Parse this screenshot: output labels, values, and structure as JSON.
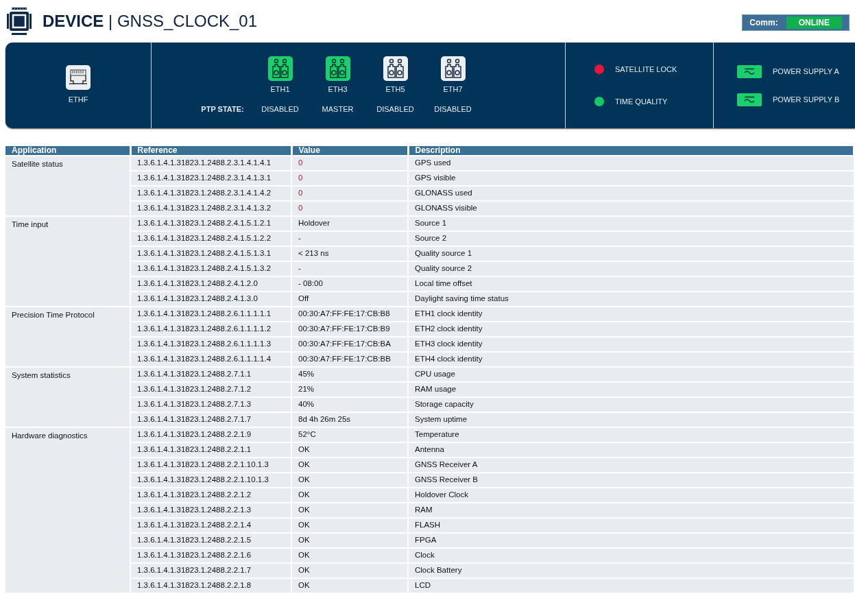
{
  "header": {
    "title_bold": "DEVICE",
    "separator": "|",
    "title_rest": "GNSS_CLOCK_01",
    "comm_label": "Comm:",
    "comm_status": "ONLINE",
    "comm_online": true
  },
  "panel": {
    "front_port": {
      "label": "ETHF"
    },
    "ptp_label": "PTP STATE:",
    "ports": [
      {
        "label": "ETH1",
        "state": "DISABLED",
        "active": true
      },
      {
        "label": "ETH3",
        "state": "MASTER",
        "active": true
      },
      {
        "label": "ETH5",
        "state": "DISABLED",
        "active": false
      },
      {
        "label": "ETH7",
        "state": "DISABLED",
        "active": false
      }
    ],
    "indicators": [
      {
        "label": "SATELLITE LOCK",
        "color": "#e8163c"
      },
      {
        "label": "TIME QUALITY",
        "color": "#17c964"
      }
    ],
    "power_supplies": [
      {
        "label": "POWER SUPPLY A",
        "on": true
      },
      {
        "label": "POWER SUPPLY B",
        "on": true
      }
    ]
  },
  "table": {
    "columns": [
      "Application",
      "Reference",
      "Value",
      "Description"
    ],
    "groups": [
      {
        "application": "Satellite status",
        "rows": [
          {
            "reference": "1.3.6.1.4.1.31823.1.2488.2.3.1.4.1.4.1",
            "value": "0",
            "alert": true,
            "description": "GPS used"
          },
          {
            "reference": "1.3.6.1.4.1.31823.1.2488.2.3.1.4.1.3.1",
            "value": "0",
            "alert": true,
            "description": "GPS visible"
          },
          {
            "reference": "1.3.6.1.4.1.31823.1.2488.2.3.1.4.1.4.2",
            "value": "0",
            "alert": true,
            "description": "GLONASS used"
          },
          {
            "reference": "1.3.6.1.4.1.31823.1.2488.2.3.1.4.1.3.2",
            "value": "0",
            "alert": true,
            "description": "GLONASS visible"
          }
        ]
      },
      {
        "application": "Time input",
        "rows": [
          {
            "reference": "1.3.6.1.4.1.31823.1.2488.2.4.1.5.1.2.1",
            "value": "Holdover",
            "alert": false,
            "description": "Source 1"
          },
          {
            "reference": "1.3.6.1.4.1.31823.1.2488.2.4.1.5.1.2.2",
            "value": "-",
            "alert": false,
            "description": "Source 2"
          },
          {
            "reference": "1.3.6.1.4.1.31823.1.2488.2.4.1.5.1.3.1",
            "value": "< 213 ns",
            "alert": false,
            "description": "Quality source 1"
          },
          {
            "reference": "1.3.6.1.4.1.31823.1.2488.2.4.1.5.1.3.2",
            "value": "-",
            "alert": false,
            "description": "Quality source 2"
          },
          {
            "reference": "1.3.6.1.4.1.31823.1.2488.2.4.1.2.0",
            "value": "- 08:00",
            "alert": false,
            "description": "Local time offset"
          },
          {
            "reference": "1.3.6.1.4.1.31823.1.2488.2.4.1.3.0",
            "value": "Off",
            "alert": false,
            "description": "Daylight saving time status"
          }
        ]
      },
      {
        "application": "Precision Time Protocol",
        "rows": [
          {
            "reference": "1.3.6.1.4.1.31823.1.2488.2.6.1.1.1.1.1",
            "value": "00:30:A7:FF:FE:17:CB:B8",
            "alert": false,
            "description": "ETH1 clock identity"
          },
          {
            "reference": "1.3.6.1.4.1.31823.1.2488.2.6.1.1.1.1.2",
            "value": "00:30:A7:FF:FE:17:CB:B9",
            "alert": false,
            "description": "ETH2 clock identity"
          },
          {
            "reference": "1.3.6.1.4.1.31823.1.2488.2.6.1.1.1.1.3",
            "value": "00:30:A7:FF:FE:17:CB:BA",
            "alert": false,
            "description": "ETH3 clock identity"
          },
          {
            "reference": "1.3.6.1.4.1.31823.1.2488.2.6.1.1.1.1.4",
            "value": "00:30:A7:FF:FE:17:CB:BB",
            "alert": false,
            "description": "ETH4 clock identity"
          }
        ]
      },
      {
        "application": "System statistics",
        "rows": [
          {
            "reference": "1.3.6.1.4.1.31823.1.2488.2.7.1.1",
            "value": "45%",
            "alert": false,
            "description": "CPU usage"
          },
          {
            "reference": "1.3.6.1.4.1.31823.1.2488.2.7.1.2",
            "value": "21%",
            "alert": false,
            "description": "RAM usage"
          },
          {
            "reference": "1.3.6.1.4.1.31823.1.2488.2.7.1.3",
            "value": "40%",
            "alert": false,
            "description": "Storage capacity"
          },
          {
            "reference": "1.3.6.1.4.1.31823.1.2488.2.7.1.7",
            "value": "8d 4h 26m 25s",
            "alert": false,
            "description": "System uptime"
          }
        ]
      },
      {
        "application": "Hardware diagnostics",
        "rows": [
          {
            "reference": "1.3.6.1.4.1.31823.1.2488.2.2.1.9",
            "value": "52°C",
            "alert": false,
            "description": "Temperature"
          },
          {
            "reference": "1.3.6.1.4.1.31823.1.2488.2.2.1.1",
            "value": "OK",
            "alert": false,
            "description": "Antenna"
          },
          {
            "reference": "1.3.6.1.4.1.31823.1.2488.2.2.1.10.1.3",
            "value": "OK",
            "alert": false,
            "description": "GNSS Receiver A"
          },
          {
            "reference": "1.3.6.1.4.1.31823.1.2488.2.2.1.10.1.3",
            "value": "OK",
            "alert": false,
            "description": "GNSS Receiver B"
          },
          {
            "reference": "1.3.6.1.4.1.31823.1.2488.2.2.1.2",
            "value": "OK",
            "alert": false,
            "description": "Holdover Clock"
          },
          {
            "reference": "1.3.6.1.4.1.31823.1.2488.2.2.1.3",
            "value": "OK",
            "alert": false,
            "description": "RAM"
          },
          {
            "reference": "1.3.6.1.4.1.31823.1.2488.2.2.1.4",
            "value": "OK",
            "alert": false,
            "description": "FLASH"
          },
          {
            "reference": "1.3.6.1.4.1.31823.1.2488.2.2.1.5",
            "value": "OK",
            "alert": false,
            "description": "FPGA"
          },
          {
            "reference": "1.3.6.1.4.1.31823.1.2488.2.2.1.6",
            "value": "OK",
            "alert": false,
            "description": "Clock"
          },
          {
            "reference": "1.3.6.1.4.1.31823.1.2488.2.2.1.7",
            "value": "OK",
            "alert": false,
            "description": "Clock Battery"
          },
          {
            "reference": "1.3.6.1.4.1.31823.1.2488.2.2.1.8",
            "value": "OK",
            "alert": false,
            "description": "LCD"
          }
        ]
      }
    ]
  }
}
